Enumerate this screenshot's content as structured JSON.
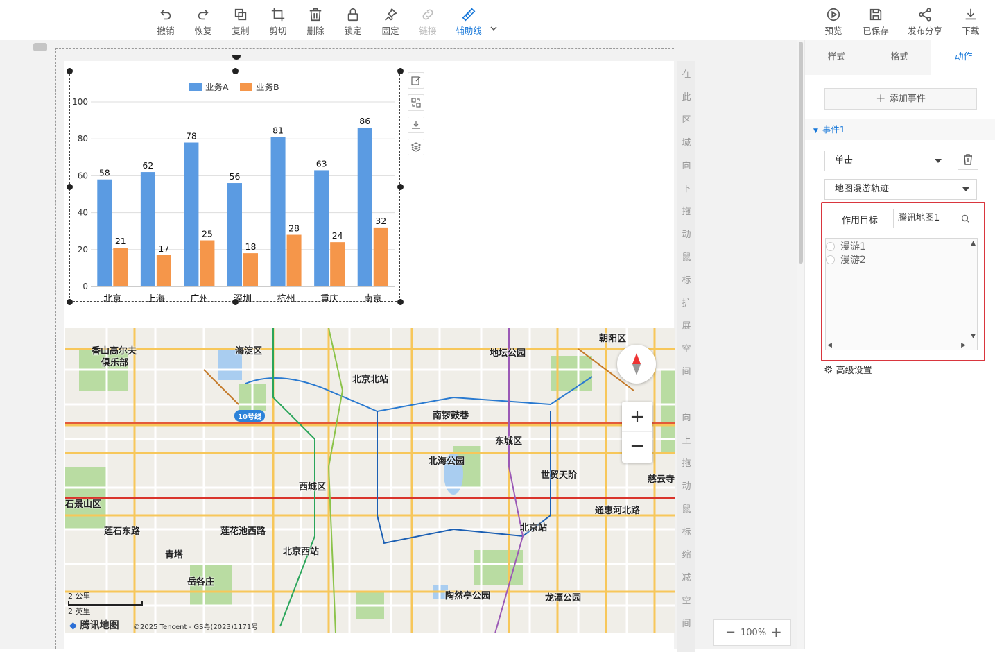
{
  "toolbar": {
    "left": [
      {
        "label": "撤销",
        "icon": "undo-icon",
        "state": "normal"
      },
      {
        "label": "恢复",
        "icon": "redo-icon",
        "state": "normal"
      },
      {
        "label": "复制",
        "icon": "copy-icon",
        "state": "normal"
      },
      {
        "label": "剪切",
        "icon": "crop-icon",
        "state": "normal"
      },
      {
        "label": "删除",
        "icon": "trash-icon",
        "state": "normal"
      },
      {
        "label": "锁定",
        "icon": "lock-icon",
        "state": "normal"
      },
      {
        "label": "固定",
        "icon": "pin-icon",
        "state": "normal"
      },
      {
        "label": "链接",
        "icon": "link-icon",
        "state": "disabled"
      },
      {
        "label": "辅助线",
        "icon": "ruler-icon",
        "state": "active"
      }
    ],
    "right": [
      {
        "label": "预览",
        "icon": "play-icon"
      },
      {
        "label": "已保存",
        "icon": "save-icon"
      },
      {
        "label": "发布分享",
        "icon": "share-icon"
      },
      {
        "label": "下载",
        "icon": "download-icon"
      }
    ]
  },
  "canvas": {
    "hint_top": [
      "在",
      "此",
      "区",
      "域",
      "向",
      "下",
      "拖",
      "动",
      "鼠",
      "标",
      "扩",
      "展",
      "空",
      "间"
    ],
    "hint_bottom": [
      "向",
      "上",
      "拖",
      "动",
      "鼠",
      "标",
      "缩",
      "减",
      "空",
      "间"
    ],
    "zoom_level": "100%"
  },
  "chart_data": {
    "type": "bar",
    "categories": [
      "北京",
      "上海",
      "广州",
      "深圳",
      "杭州",
      "重庆",
      "南京"
    ],
    "series": [
      {
        "name": "业务A",
        "values": [
          58,
          62,
          78,
          56,
          81,
          63,
          86
        ],
        "color": "#5b9be2"
      },
      {
        "name": "业务B",
        "values": [
          21,
          17,
          25,
          18,
          28,
          24,
          32
        ],
        "color": "#f5964a"
      }
    ],
    "ylim": [
      0,
      100
    ],
    "yticks": [
      0,
      20,
      40,
      60,
      80,
      100
    ],
    "legend": "top-center",
    "grid": true
  },
  "map": {
    "labels": [
      {
        "text": "海淀区"
      },
      {
        "text": "朝阳区"
      },
      {
        "text": "香山高尔夫"
      },
      {
        "text": "俱乐部"
      },
      {
        "text": "地坛公园"
      },
      {
        "text": "北京北站"
      },
      {
        "text": "10号线"
      },
      {
        "text": "南锣鼓巷"
      },
      {
        "text": "东城区"
      },
      {
        "text": "北海公园"
      },
      {
        "text": "世贸天阶"
      },
      {
        "text": "西城区"
      },
      {
        "text": "石景山区"
      },
      {
        "text": "通惠河北路"
      },
      {
        "text": "北京站"
      },
      {
        "text": "莲石东路"
      },
      {
        "text": "莲花池西路"
      },
      {
        "text": "北京西站"
      },
      {
        "text": "青塔"
      },
      {
        "text": "岳各庄"
      },
      {
        "text": "陶然亭公园"
      },
      {
        "text": "龙潭公园"
      },
      {
        "text": "慈云寺"
      }
    ],
    "scale_km": "2 公里",
    "scale_mi": "2 英里",
    "logo": "腾讯地图",
    "copyright": "©2025 Tencent - GS粤(2023)1171号"
  },
  "panel": {
    "tabs": [
      "样式",
      "格式",
      "动作"
    ],
    "active_tab": "动作",
    "add_event": "添加事件",
    "event_title": "事件1",
    "trigger": "单击",
    "action": "地图漫游轨迹",
    "target_label": "作用目标",
    "target_value": "腾讯地图1",
    "roam_items": [
      "漫游1",
      "漫游2"
    ],
    "advanced": "高级设置"
  }
}
